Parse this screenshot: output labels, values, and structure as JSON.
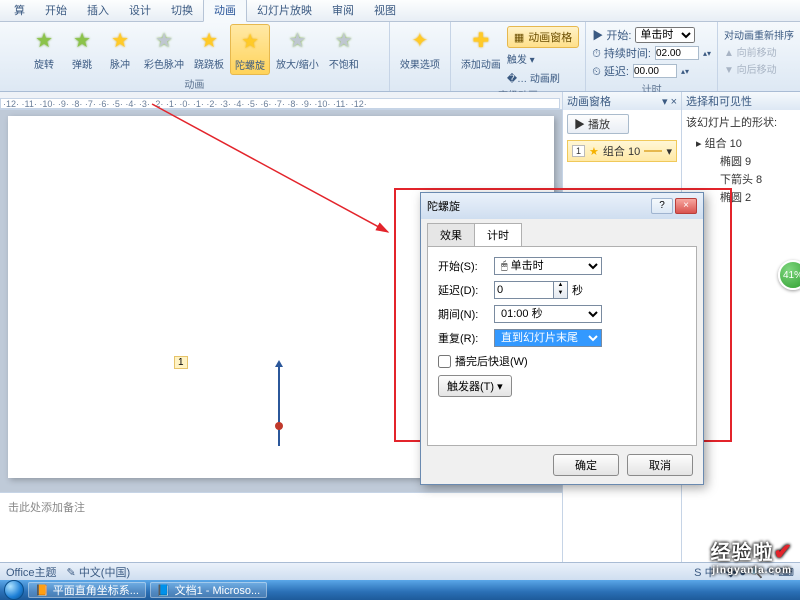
{
  "tabs": [
    "算",
    "开始",
    "插入",
    "设计",
    "切换",
    "动画",
    "幻灯片放映",
    "审阅",
    "视图"
  ],
  "active_tab_index": 5,
  "ribbon": {
    "anims": [
      {
        "label": "旋转",
        "cls": "star"
      },
      {
        "label": "弹跳",
        "cls": "star"
      },
      {
        "label": "脉冲",
        "cls": "star y"
      },
      {
        "label": "彩色脉冲",
        "cls": "star g"
      },
      {
        "label": "跷跷板",
        "cls": "star y"
      },
      {
        "label": "陀螺旋",
        "cls": "star y",
        "sel": true
      },
      {
        "label": "放大/缩小",
        "cls": "star g"
      },
      {
        "label": "不饱和",
        "cls": "star g"
      }
    ],
    "effect_options": "效果选项",
    "add_anim": "添加动画",
    "pane_btn": "动画窗格",
    "trigger": "触发 ▾",
    "painter": "�… 动画刷",
    "adv_group": "高级动画",
    "timing_group": "计时",
    "start_lbl": "▶ 开始:",
    "start_val": "单击时",
    "dur_lbl": "⏱ 持续时间:",
    "dur_val": "02.00",
    "delay_lbl": "⏲ 延迟:",
    "delay_val": "00.00",
    "reorder": "对动画重新排序",
    "move_up": "▲ 向前移动",
    "move_down": "▼ 向后移动"
  },
  "ruler_caption": "动画",
  "ruler_text": "·12· ·11· ·10· ·9· ·8· ·7· ·6· ·5· ·4· ·3· ·2· ·1· ·0· ·1· ·2· ·3· ·4· ·5· ·6· ·7· ·8· ·9· ·10· ·11· ·12·",
  "pane_anim": {
    "title": "动画窗格",
    "close": "×",
    "play": "▶ 播放",
    "item_num": "1",
    "item_star": "★",
    "item_name": "组合 10",
    "item_drop": "▾"
  },
  "pane_sel": {
    "title": "选择和可见性",
    "heading": "该幻灯片上的形状:",
    "root": "▸ 组合 10",
    "children": [
      "椭圆 9",
      "下箭头 8",
      "椭圆 2"
    ]
  },
  "slide": {
    "marker": "1"
  },
  "dialog": {
    "title": "陀螺旋",
    "help": "?",
    "close": "×",
    "tabs": [
      "效果",
      "计时"
    ],
    "active_tab": 1,
    "rows": {
      "start": {
        "lbl": "开始(S):",
        "val": "🖱 单击时"
      },
      "delay": {
        "lbl": "延迟(D):",
        "val": "0",
        "unit": "秒"
      },
      "duration": {
        "lbl": "期间(N):",
        "val": "01:00 秒"
      },
      "repeat": {
        "lbl": "重复(R):",
        "val": "直到幻灯片末尾"
      }
    },
    "rewind": "播完后快退(W)",
    "triggers": "触发器(T) ▾",
    "ok": "确定",
    "cancel": "取消"
  },
  "notes_placeholder": "击此处添加备注",
  "status": {
    "office": "Office主题",
    "lang": "中文(中国)",
    "ime_icons": "S 中 · ❖ ● 🔍 ✎ ⌨"
  },
  "taskbar": {
    "items": [
      {
        "icon": "📙",
        "label": "平面直角坐标系..."
      },
      {
        "icon": "📘",
        "label": "文档1 - Microso..."
      }
    ]
  },
  "badge": "41%",
  "watermark": {
    "big": "经验啦",
    "small": "jingyanla.com"
  }
}
